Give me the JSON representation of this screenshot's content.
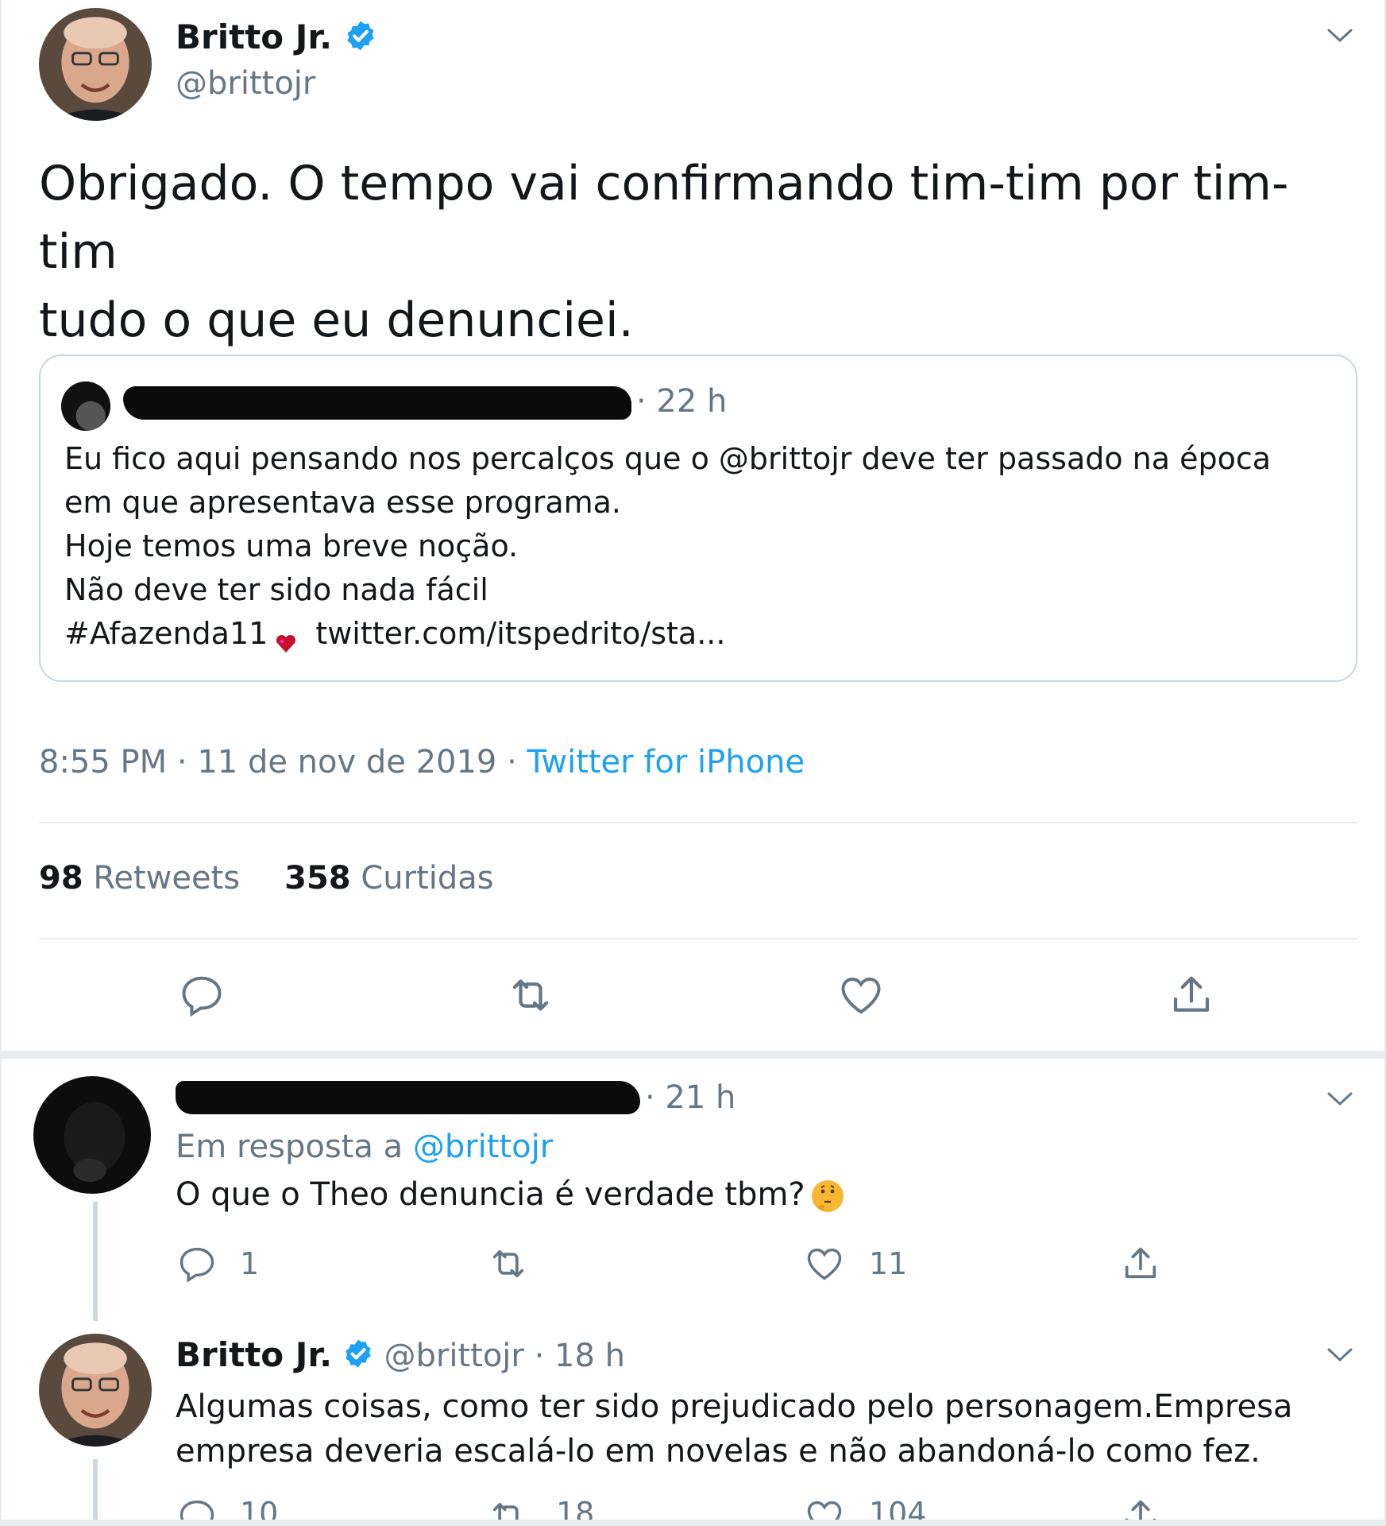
{
  "main_tweet": {
    "author_name": "Britto Jr.",
    "author_handle": "@brittojr",
    "text_line1": "Obrigado. O tempo vai confirmando tim-tim por tim-tim",
    "text_line2": "tudo o que eu denunciei.",
    "time": "8:55 PM",
    "date": "11 de nov de 2019",
    "source": "Twitter for iPhone",
    "retweets_count": "98",
    "retweets_label": "Retweets",
    "likes_count": "358",
    "likes_label": "Curtidas",
    "icons": [
      "reply-icon",
      "retweet-icon",
      "like-icon",
      "share-icon",
      "chevron-down-icon",
      "verified-badge-icon"
    ]
  },
  "quoted_tweet": {
    "time": "· 22 h",
    "lines": [
      "Eu fico aqui pensando nos percalços que o @brittojr deve ter passado na época",
      "em que apresentava esse programa.",
      "Hoje temos uma breve noção.",
      "Não deve ter sido nada fácil"
    ],
    "hashtag": "#Afazenda11",
    "link": "twitter.com/itspedrito/sta..."
  },
  "reply1": {
    "time": "· 21 h",
    "reply_prefix": "Em resposta a",
    "reply_mention": "@brittojr",
    "text": "O que o Theo denuncia é verdade tbm?",
    "reply_count": "1",
    "like_count": "11"
  },
  "reply2": {
    "author_name": "Britto Jr.",
    "author_handle": "@brittojr",
    "time": "· 18 h",
    "text_line1": "Algumas coisas, como ter sido prejudicado pelo personagem.Empresa",
    "text_line2": "empresa deveria escalá-lo em novelas e não abandoná-lo como fez.",
    "reply_count": "10",
    "retweet_count": "18",
    "like_count": "104"
  },
  "colors": {
    "text": "#14171a",
    "secondary": "#657786",
    "accent": "#1da1f2",
    "border": "#e6ecf0"
  }
}
